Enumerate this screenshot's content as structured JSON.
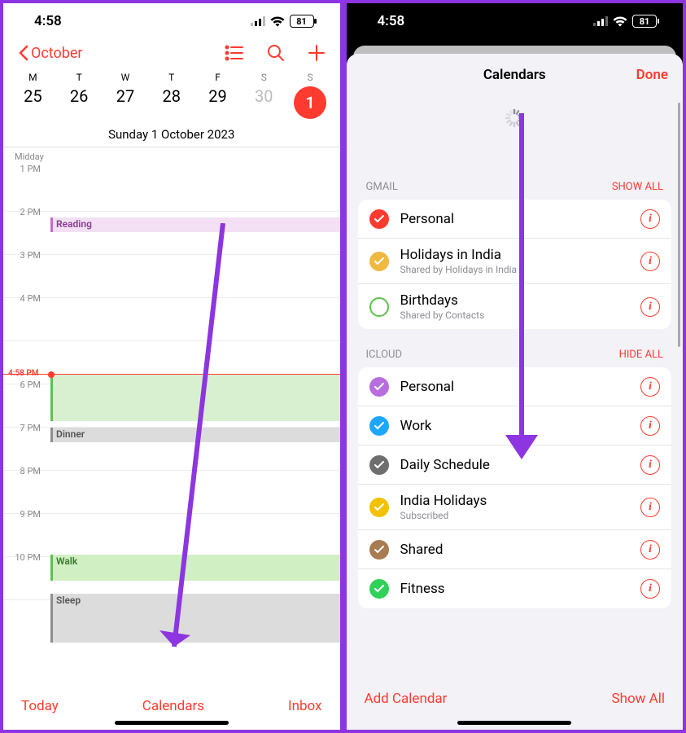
{
  "status": {
    "time": "4:58",
    "battery": "81"
  },
  "left": {
    "back": "October",
    "weekdays": [
      "M",
      "T",
      "W",
      "T",
      "F",
      "S",
      "S"
    ],
    "dates": [
      "25",
      "26",
      "27",
      "28",
      "29",
      "30",
      "1"
    ],
    "date_label": "Sunday  1 October 2023",
    "midday": "Midday",
    "times": [
      "1 PM",
      "2 PM",
      "3 PM",
      "4 PM",
      "",
      "6 PM",
      "7 PM",
      "8 PM",
      "9 PM",
      "10 PM"
    ],
    "now_label": "4:58 PM",
    "events": {
      "reading": "Reading",
      "dinner": "Dinner",
      "walk": "Walk",
      "sleep": "Sleep"
    },
    "toolbar": {
      "today": "Today",
      "calendars": "Calendars",
      "inbox": "Inbox"
    }
  },
  "right": {
    "title": "Calendars",
    "done": "Done",
    "sections": {
      "gmail": {
        "header": "GMAIL",
        "action": "SHOW ALL"
      },
      "icloud": {
        "header": "ICLOUD",
        "action": "HIDE ALL"
      }
    },
    "gmail_cals": [
      {
        "name": "Personal",
        "sub": "",
        "color": "#ff3b30",
        "checked": true
      },
      {
        "name": "Holidays in India",
        "sub": "Shared by Holidays in India",
        "color": "#f0b840",
        "checked": true
      },
      {
        "name": "Birthdays",
        "sub": "Shared by Contacts",
        "color": "#5bc24b",
        "checked": false
      }
    ],
    "icloud_cals": [
      {
        "name": "Personal",
        "sub": "",
        "color": "#b86edc",
        "checked": true
      },
      {
        "name": "Work",
        "sub": "",
        "color": "#1ea7ff",
        "checked": true
      },
      {
        "name": "Daily Schedule",
        "sub": "",
        "color": "#6e6e6e",
        "checked": true
      },
      {
        "name": "India Holidays",
        "sub": "Subscribed",
        "color": "#f2c200",
        "checked": true
      },
      {
        "name": "Shared",
        "sub": "",
        "color": "#a87b50",
        "checked": true
      },
      {
        "name": "Fitness",
        "sub": "",
        "color": "#30d158",
        "checked": true
      }
    ],
    "footer": {
      "add": "Add Calendar",
      "showall": "Show All"
    }
  }
}
